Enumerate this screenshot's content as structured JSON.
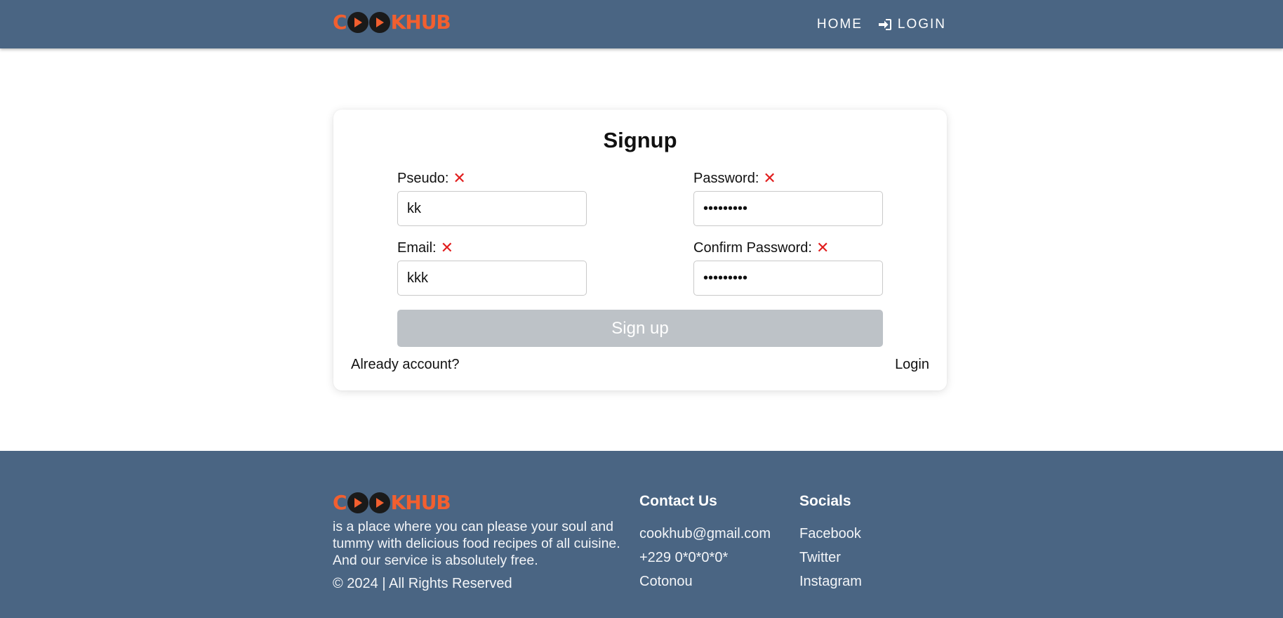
{
  "colors": {
    "bar_bg": "#4a6583",
    "logo_orange": "#f25f2f",
    "logo_dark": "#1a1a1a",
    "error_red": "#e11d1d",
    "button_disabled": "#bdc2c7"
  },
  "brand": {
    "logo_text": "COOKHUB"
  },
  "nav": {
    "home": "HOME",
    "login": "LOGIN",
    "login_icon": "sign-in-icon"
  },
  "form": {
    "title": "Signup",
    "pseudo": {
      "label": "Pseudo:",
      "value": "kk",
      "status": "invalid"
    },
    "password": {
      "label": "Password:",
      "value": "•••••••••",
      "status": "invalid"
    },
    "email": {
      "label": "Email:",
      "value": "kkk",
      "status": "invalid"
    },
    "confirm_password": {
      "label": "Confirm Password:",
      "value": "•••••••••",
      "status": "invalid"
    },
    "error_icon": "close-icon",
    "submit_label": "Sign up",
    "submit_disabled": true,
    "already_account": "Already account?",
    "login_link": "Login"
  },
  "footer": {
    "about": "is a place where you can please your soul and tummy with delicious food recipes of all cuisine. And our service is absolutely free.",
    "copyright": "© 2024 | All Rights Reserved",
    "contact": {
      "heading": "Contact Us",
      "email": "cookhub@gmail.com",
      "phone": "+229 0*0*0*0*",
      "city": "Cotonou"
    },
    "socials": {
      "heading": "Socials",
      "items": [
        "Facebook",
        "Twitter",
        "Instagram"
      ]
    }
  }
}
